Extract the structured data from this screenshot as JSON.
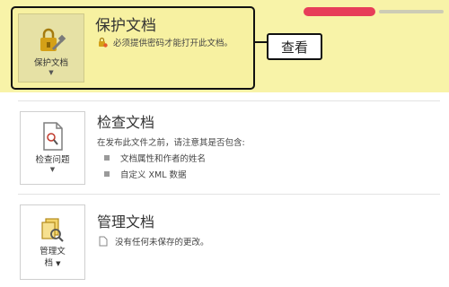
{
  "protect": {
    "button_label": "保护文档",
    "title": "保护文档",
    "description": "必须提供密码才能打开此文档。"
  },
  "callout": {
    "label": "查看"
  },
  "inspect": {
    "button_label": "检查问题",
    "title": "检查文档",
    "intro": "在发布此文件之前，请注意其是否包含:",
    "items": [
      "文档属性和作者的姓名",
      "自定义 XML 数据"
    ]
  },
  "manage": {
    "button_label_line1": "管理文",
    "button_label_line2": "档",
    "title": "管理文档",
    "note": "没有任何未保存的更改。"
  },
  "colors": {
    "band": "#f8f3a8",
    "frame": "#111111",
    "accent": "#e2003f"
  },
  "icons": [
    "lock-key-icon",
    "warning-lock-icon",
    "document-check-icon",
    "manage-document-icon",
    "file-note-icon",
    "chevron-down-icon"
  ]
}
